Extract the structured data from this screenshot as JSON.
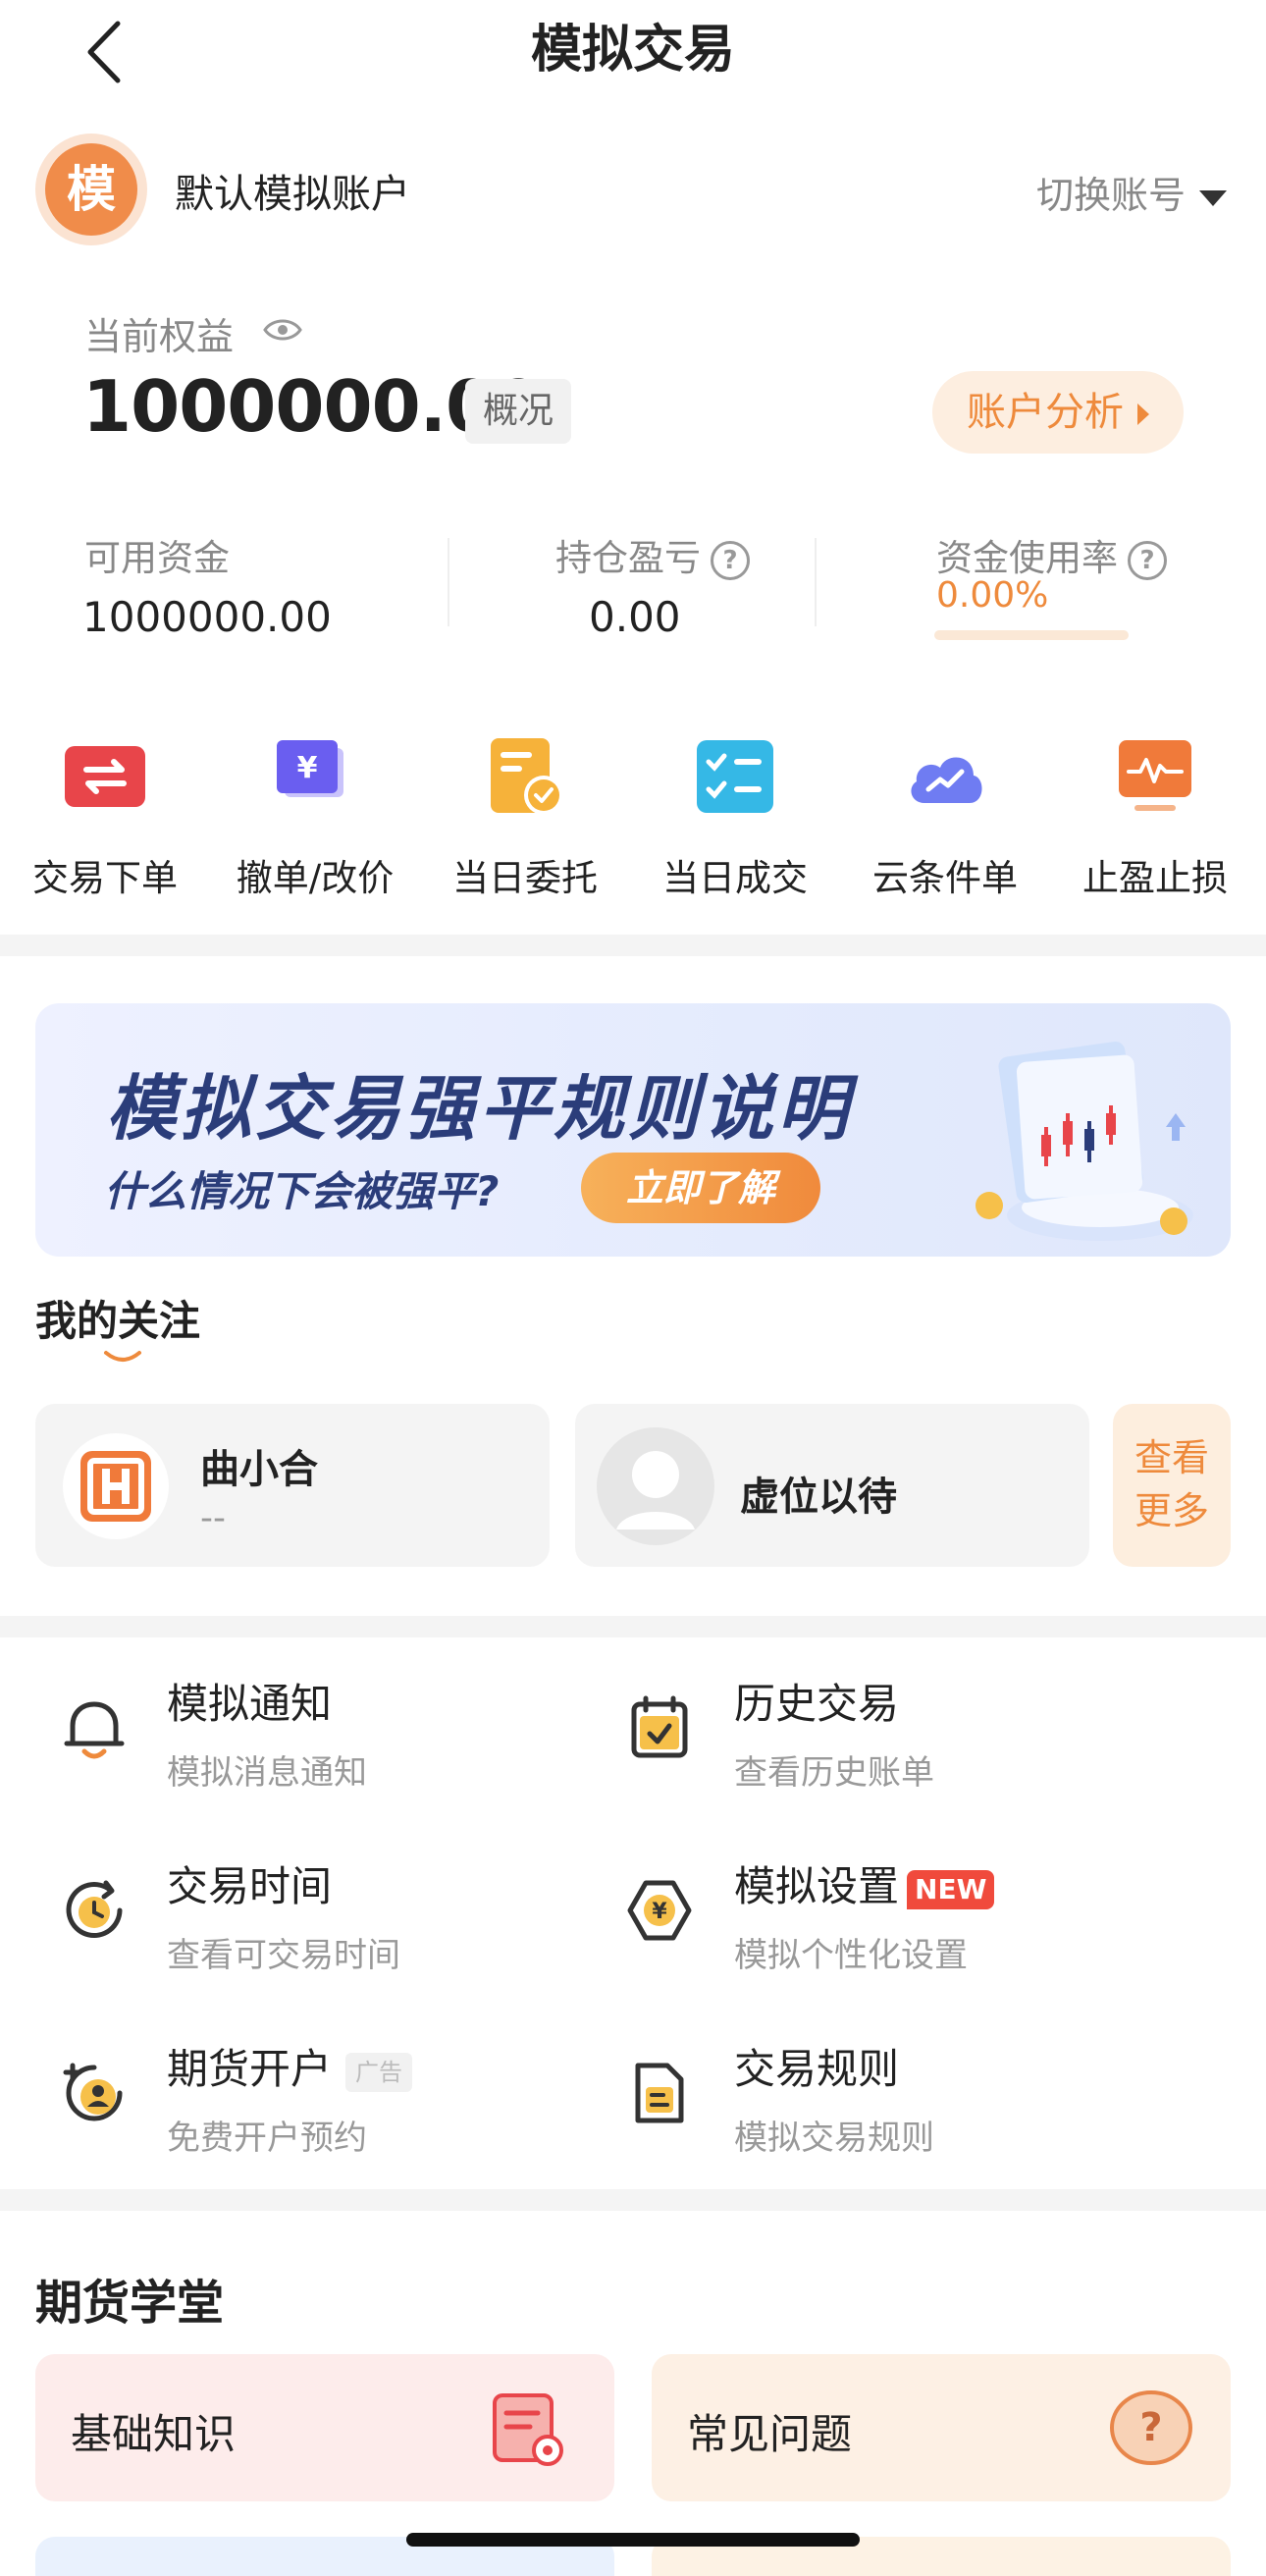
{
  "header": {
    "title": "模拟交易"
  },
  "account": {
    "avatar_char": "模",
    "name": "默认模拟账户",
    "switch_label": "切换账号"
  },
  "equity": {
    "label": "当前权益",
    "value": "1000000.00",
    "overview_label": "概况",
    "analysis_label": "账户分析"
  },
  "stats": {
    "available_label": "可用资金",
    "available_value": "1000000.00",
    "pnl_label": "持仓盈亏",
    "pnl_value": "0.00",
    "usage_label": "资金使用率",
    "usage_value": "0.00%"
  },
  "quick_actions": [
    {
      "label": "交易下单",
      "icon": "swap-icon"
    },
    {
      "label": "撤单/改价",
      "icon": "yuan-card-icon"
    },
    {
      "label": "当日委托",
      "icon": "order-check-icon"
    },
    {
      "label": "当日成交",
      "icon": "checklist-icon"
    },
    {
      "label": "云条件单",
      "icon": "cloud-icon"
    },
    {
      "label": "止盈止损",
      "icon": "chart-monitor-icon"
    }
  ],
  "banner": {
    "title": "模拟交易强平规则说明",
    "subtitle": "什么情况下会被强平?",
    "button": "立即了解"
  },
  "follows": {
    "title": "我的关注",
    "items": [
      {
        "name": "曲小合",
        "sub": "--"
      },
      {
        "name": "虚位以待"
      }
    ],
    "more_label_1": "查看",
    "more_label_2": "更多"
  },
  "menu": [
    {
      "title": "模拟通知",
      "sub": "模拟消息通知",
      "icon": "bell-icon"
    },
    {
      "title": "历史交易",
      "sub": "查看历史账单",
      "icon": "calendar-check-icon"
    },
    {
      "title": "交易时间",
      "sub": "查看可交易时间",
      "icon": "clock-icon"
    },
    {
      "title": "模拟设置",
      "sub": "模拟个性化设置",
      "icon": "yuan-hexagon-icon",
      "badge": "NEW"
    },
    {
      "title": "期货开户",
      "sub": "免费开户预约",
      "icon": "add-user-icon",
      "badge": "广告"
    },
    {
      "title": "交易规则",
      "sub": "模拟交易规则",
      "icon": "document-icon"
    }
  ],
  "school": {
    "title": "期货学堂",
    "items": [
      {
        "label": "基础知识",
        "icon": "book-icon"
      },
      {
        "label": "常见问题",
        "icon": "question-icon"
      }
    ]
  },
  "colors": {
    "accent": "#ee8a3c",
    "banner_text": "#2b3d7a",
    "new_badge": "#f04a3c"
  }
}
